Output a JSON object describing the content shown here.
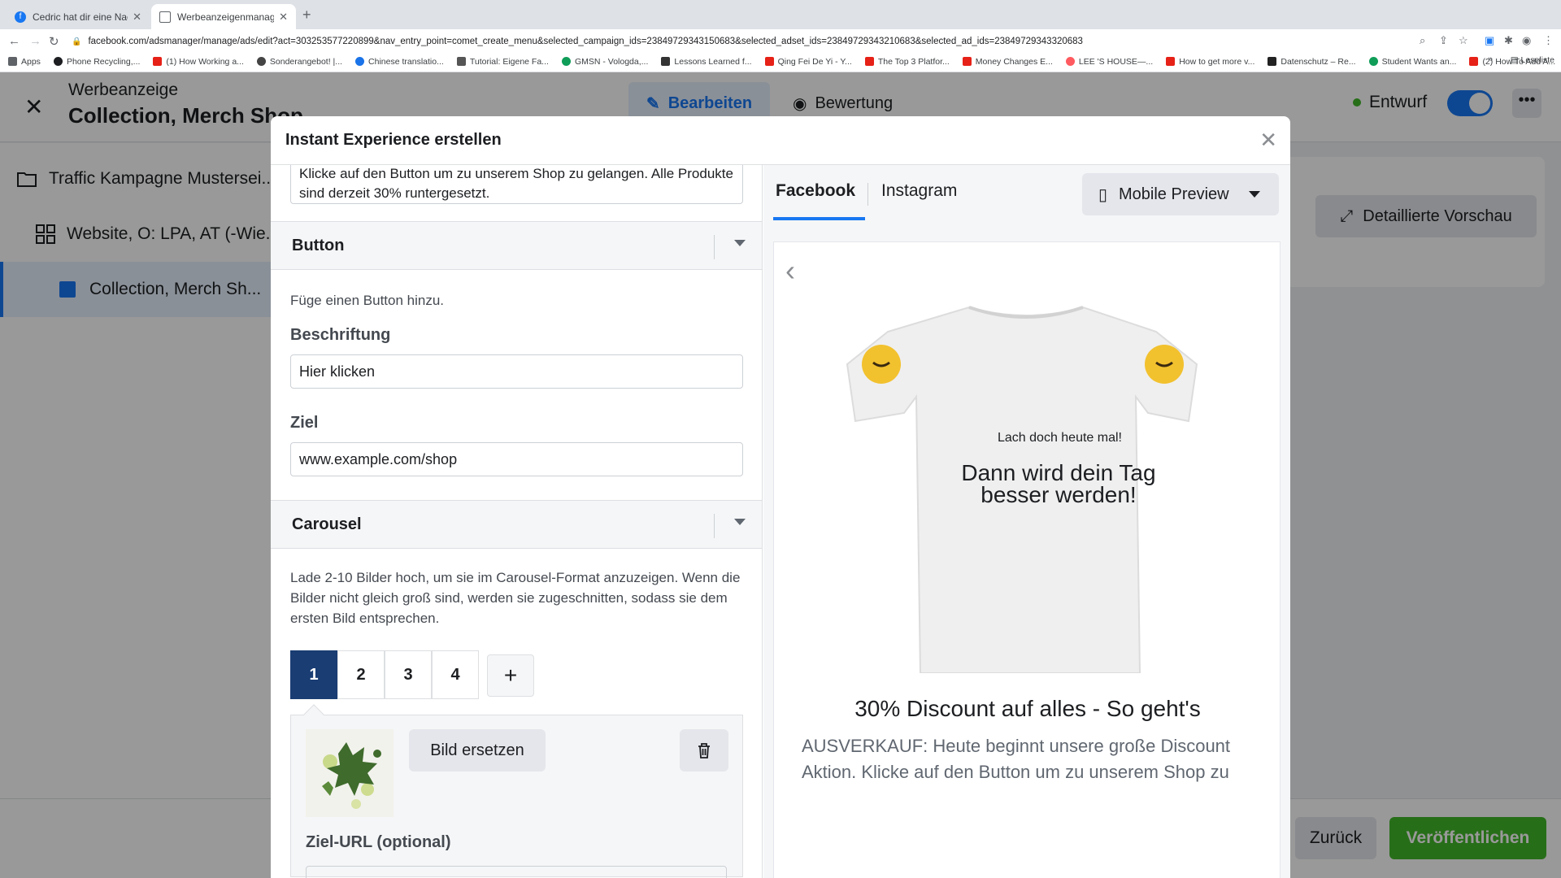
{
  "browser": {
    "tabs": [
      {
        "title": "Cedric hat dir eine Nachricht g",
        "active": false
      },
      {
        "title": "Werbeanzeigenmanager - Wer",
        "active": true
      }
    ],
    "url": "facebook.com/adsmanager/manage/ads/edit?act=303253577220899&nav_entry_point=comet_create_menu&selected_campaign_ids=23849729343150683&selected_adset_ids=23849729343210683&selected_ad_ids=23849729343320683",
    "bookmarks": [
      {
        "label": "Apps",
        "color": "#5f6368"
      },
      {
        "label": "Phone Recycling,...",
        "color": "#1c1e21"
      },
      {
        "label": "(1) How Working a...",
        "color": "#e62117"
      },
      {
        "label": "Sonderangebot! |...",
        "color": "#444"
      },
      {
        "label": "Chinese translatio...",
        "color": "#1a73e8"
      },
      {
        "label": "Tutorial: Eigene Fa...",
        "color": "#555"
      },
      {
        "label": "GMSN - Vologda,...",
        "color": "#0f9d58"
      },
      {
        "label": "Lessons Learned f...",
        "color": "#333"
      },
      {
        "label": "Qing Fei De Yi - Y...",
        "color": "#e62117"
      },
      {
        "label": "The Top 3 Platfor...",
        "color": "#e62117"
      },
      {
        "label": "Money Changes E...",
        "color": "#e62117"
      },
      {
        "label": "LEE 'S HOUSE—...",
        "color": "#ff5a5f"
      },
      {
        "label": "How to get more v...",
        "color": "#e62117"
      },
      {
        "label": "Datenschutz – Re...",
        "color": "#222"
      },
      {
        "label": "Student Wants an...",
        "color": "#0f9d58"
      },
      {
        "label": "(2) How To Add A...",
        "color": "#e62117"
      }
    ],
    "more_bookmarks": "»",
    "reading_list": "Leseliste"
  },
  "app": {
    "kicker": "Werbeanzeige",
    "title": "Collection, Merch Shop",
    "edit_tab": "Bearbeiten",
    "review_tab": "Bewertung",
    "status": "Entwurf",
    "tree": [
      {
        "label": "Traffic Kampagne Mustersei...",
        "icon": "folder-icon"
      },
      {
        "label": "Website, O: LPA, AT (-Wie...",
        "icon": "grid-icon"
      },
      {
        "label": "Collection, Merch Sh...",
        "icon": "ad-icon"
      }
    ],
    "detail_preview": "Detaillierte Vorschau",
    "back": "Zurück",
    "publish": "Veröffentlichen"
  },
  "modal": {
    "title": "Instant Experience erstellen",
    "intro_text": "Klicke auf den Button um zu unserem Shop zu gelangen. Alle Produkte sind derzeit 30% runtergesetzt.",
    "button_section": {
      "heading": "Button",
      "help": "Füge einen Button hinzu.",
      "label_caption": "Beschriftung",
      "label_value": "Hier klicken",
      "target_caption": "Ziel",
      "target_value": "www.example.com/shop"
    },
    "carousel_section": {
      "heading": "Carousel",
      "help": "Lade 2-10 Bilder hoch, um sie im Carousel-Format anzuzeigen. Wenn die Bilder nicht gleich groß sind, werden sie zugeschnitten, sodass sie dem ersten Bild entsprechen.",
      "tabs": [
        "1",
        "2",
        "3",
        "4"
      ],
      "active_tab": "1",
      "add": "+",
      "replace_image": "Bild ersetzen",
      "url_caption": "Ziel-URL (optional)"
    },
    "preview": {
      "tab_facebook": "Facebook",
      "tab_instagram": "Instagram",
      "mobile_preview": "Mobile Preview",
      "shirt_small_text": "Lach doch heute mal!",
      "shirt_big_text": "Dann wird dein Tag besser werden!",
      "headline": "30% Discount auf alles - So geht's",
      "body": "AUSVERKAUF: Heute beginnt unsere große Discount Aktion. Klicke auf den Button um zu unserem Shop zu"
    }
  },
  "colors": {
    "accent": "#1877f2",
    "active_tab": "#1a3d73",
    "publish": "#42b72a"
  }
}
